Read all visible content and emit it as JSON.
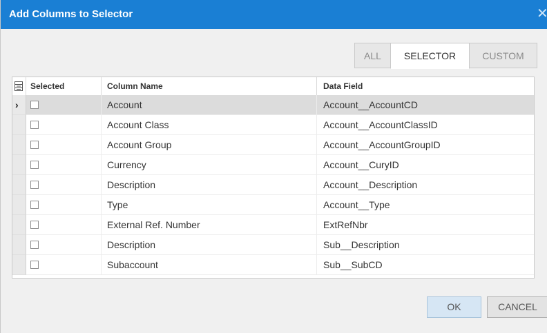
{
  "dialog": {
    "title": "Add Columns to Selector",
    "close_glyph": "✕"
  },
  "tabs": [
    {
      "label": "ALL",
      "active": false
    },
    {
      "label": "SELECTOR",
      "active": true
    },
    {
      "label": "CUSTOM",
      "active": false
    }
  ],
  "grid": {
    "columns": {
      "selected": "Selected",
      "column_name": "Column Name",
      "data_field": "Data Field"
    },
    "current_row_marker": "›",
    "rows": [
      {
        "selected": false,
        "column_name": "Account",
        "data_field": "Account__AccountCD"
      },
      {
        "selected": false,
        "column_name": "Account Class",
        "data_field": "Account__AccountClassID"
      },
      {
        "selected": false,
        "column_name": "Account Group",
        "data_field": "Account__AccountGroupID"
      },
      {
        "selected": false,
        "column_name": "Currency",
        "data_field": "Account__CuryID"
      },
      {
        "selected": false,
        "column_name": "Description",
        "data_field": "Account__Description"
      },
      {
        "selected": false,
        "column_name": "Type",
        "data_field": "Account__Type"
      },
      {
        "selected": false,
        "column_name": "External Ref. Number",
        "data_field": "ExtRefNbr"
      },
      {
        "selected": false,
        "column_name": "Description",
        "data_field": "Sub__Description"
      },
      {
        "selected": false,
        "column_name": "Subaccount",
        "data_field": "Sub__SubCD"
      }
    ]
  },
  "buttons": {
    "ok": "OK",
    "cancel": "CANCEL"
  },
  "colors": {
    "title_bar": "#1a7fd4",
    "current_row": "#dcdcdc",
    "ok_button": "#d6e6f4"
  },
  "icons": {
    "column_chooser": "column-chooser-icon",
    "close": "close-icon"
  }
}
